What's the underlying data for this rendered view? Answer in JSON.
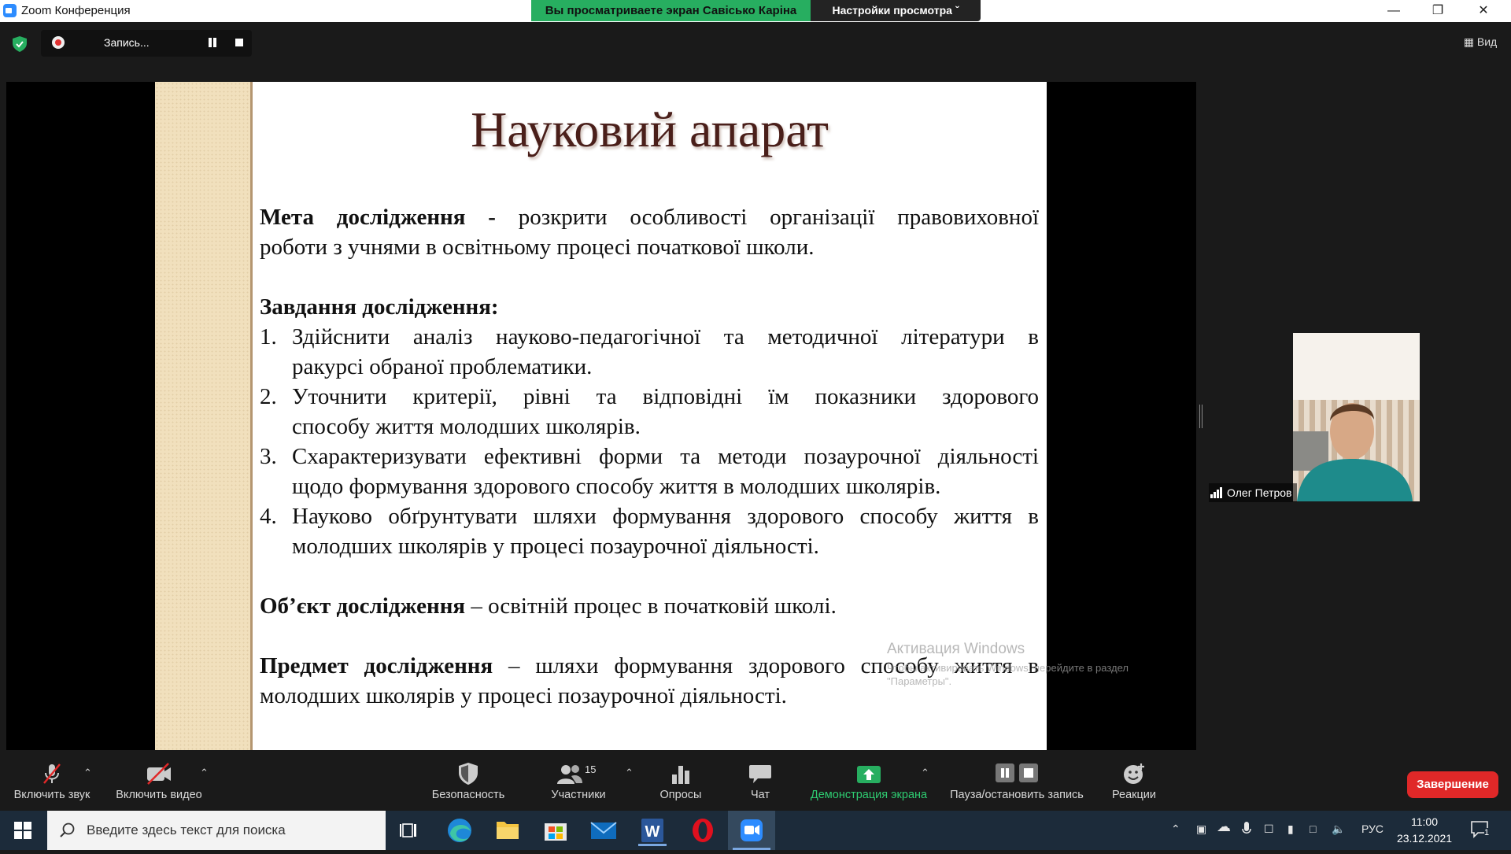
{
  "window": {
    "title": "Zoom Конференция",
    "share_banner": "Вы просматриваете экран Савісько Каріна",
    "view_options": "Настройки просмотра",
    "view_button": "Вид"
  },
  "recording": {
    "label": "Запись..."
  },
  "slide": {
    "title": "Науковий апарат",
    "lines": [
      {
        "bold": "Мета дослідження -",
        "text": " розкрити особливості організації правовиховної"
      },
      {
        "bold": "",
        "text": "роботи з учнями в освітньому процесі початкової школи."
      },
      {
        "bold": "Завдання дослідження:",
        "text": ""
      },
      {
        "num": "1.",
        "text": "Здійснити аналіз науково-педагогічної та методичної літератури в"
      },
      {
        "text": "ракурсі обраної проблематики."
      },
      {
        "num": "2.",
        "text": "Уточнити критерії, рівні та відповідні їм показники здорового"
      },
      {
        "text": "способу життя молодших школярів."
      },
      {
        "num": "3.",
        "text": "Схарактеризувати ефективні форми та методи позаурочної діяльності"
      },
      {
        "text": "щодо формування здорового способу життя в молодших школярів."
      },
      {
        "num": "4.",
        "text": "Науково обґрунтувати шляхи формування здорового способу життя в"
      },
      {
        "text": "молодших школярів у процесі позаурочної діяльності."
      },
      {
        "bold": "Об’єкт дослідження",
        "text": " – освітній процес в початковій школі."
      },
      {
        "bold": "Предмет дослідження",
        "text": " – шляхи формування здорового способу життя в"
      },
      {
        "bold": "",
        "text": "молодших школярів у процесі позаурочної діяльності."
      }
    ],
    "watermark_title": "Активация Windows",
    "watermark_text": "Чтобы активировать Windows, перейдите в раздел \"Параметры\"."
  },
  "participant": {
    "name": "Олег Петров"
  },
  "toolbar": {
    "mute": "Включить звук",
    "video": "Включить видео",
    "security": "Безопасность",
    "participants": "Участники",
    "participants_count": "15",
    "polls": "Опросы",
    "chat": "Чат",
    "share": "Демонстрация экрана",
    "pause_record": "Пауза/остановить запись",
    "reactions": "Реакции",
    "end": "Завершение"
  },
  "taskbar": {
    "search_placeholder": "Введите здесь текст для поиска",
    "language": "РУС",
    "time": "11:00",
    "date": "23.12.2021",
    "notifications": "1"
  },
  "colors": {
    "share_green": "#27ae60",
    "end_red": "#e02828",
    "zoom_blue": "#2d8cff"
  }
}
